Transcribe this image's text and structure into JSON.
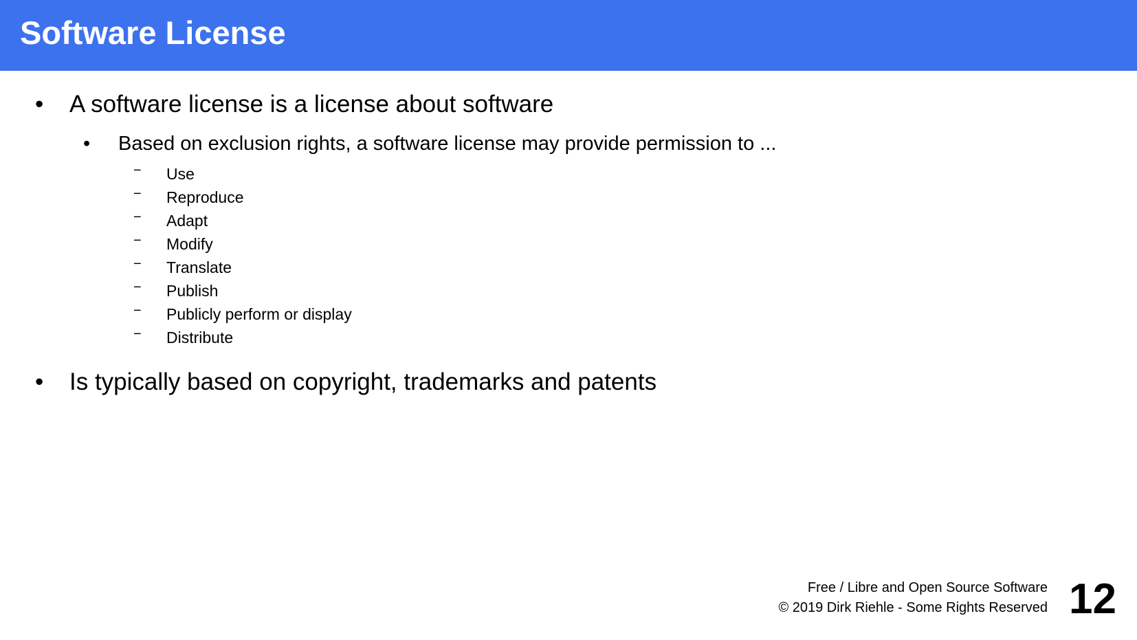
{
  "slide": {
    "title": "Software License",
    "title_bar_color": "#3d72ee"
  },
  "content": {
    "bullet_symbol": "•",
    "dash_symbol": "−",
    "bullets": [
      {
        "text": "A software license is a license about software",
        "sub": {
          "text": "Based on exclusion rights, a software license may provide permission to ...",
          "items": [
            "Use",
            "Reproduce",
            "Adapt",
            "Modify",
            "Translate",
            "Publish",
            "Publicly perform or display",
            "Distribute"
          ]
        }
      },
      {
        "text": "Is typically based on copyright, trademarks and patents"
      }
    ]
  },
  "footer": {
    "line1": "Free / Libre and Open Source Software",
    "line2": "© 2019 Dirk Riehle - Some Rights Reserved",
    "page_number": "12"
  }
}
